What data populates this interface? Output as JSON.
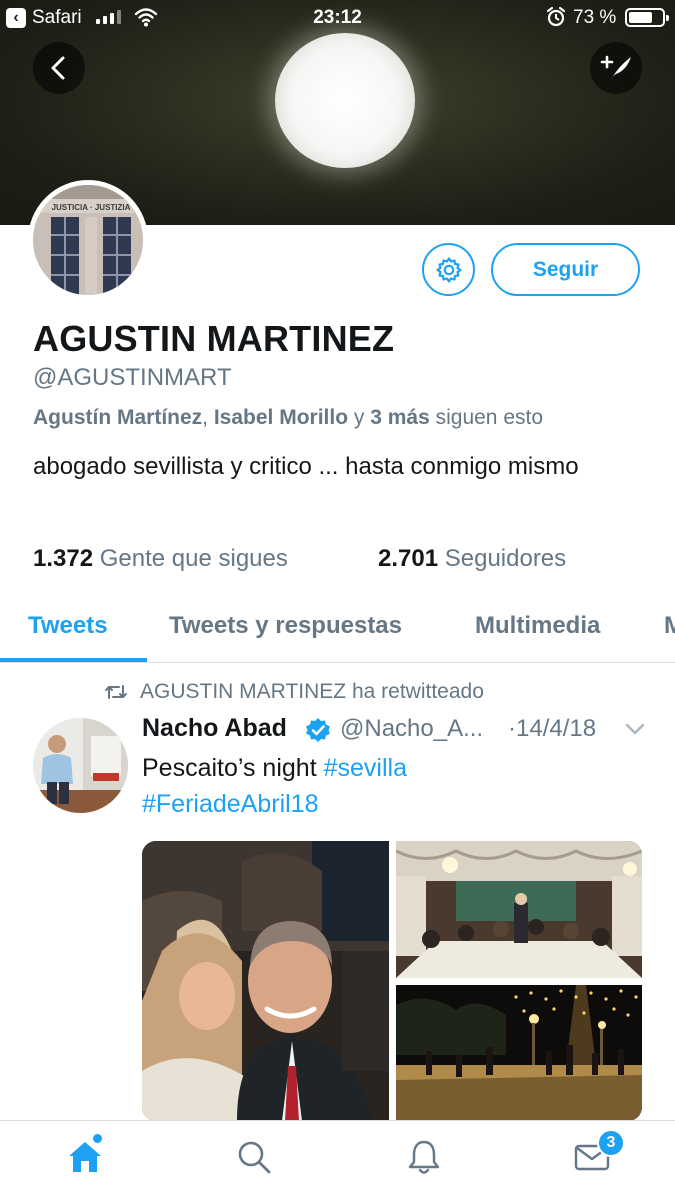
{
  "status_bar": {
    "back_app": "Safari",
    "time": "23:12",
    "battery_percent": "73 %",
    "battery_level": 0.73,
    "icons": [
      "signal-icon",
      "wifi-icon",
      "alarm-icon",
      "battery-icon"
    ]
  },
  "header": {
    "icons": [
      "back-arrow-icon",
      "compose-tweet-icon"
    ]
  },
  "profile": {
    "display_name": "AGUSTIN MARTINEZ",
    "handle": "@AGUSTINMART",
    "followed_by": {
      "name1": "Agustín Martínez",
      "sep": ", ",
      "name2": "Isabel Morillo",
      "and": " y ",
      "more": "3 más",
      "suffix": " siguen esto"
    },
    "bio": "abogado sevillista y critico ... hasta conmigo mismo",
    "following_count": "1.372",
    "following_label": "Gente que sigues",
    "followers_count": "2.701",
    "followers_label": "Seguidores",
    "follow_button": "Seguir",
    "avatar_sign": "JUSTICIA · JUSTIZIA"
  },
  "tabs": [
    {
      "label": "Tweets",
      "active": true
    },
    {
      "label": "Tweets y respuestas",
      "active": false
    },
    {
      "label": "Multimedia",
      "active": false
    },
    {
      "label": "M",
      "active": false
    }
  ],
  "tweet": {
    "retweet_label": "AGUSTIN MARTINEZ ha retwitteado",
    "author_name": "Nacho Abad",
    "author_handle": "@Nacho_A...",
    "date": "·14/4/18",
    "text_plain": "Pescaito’s night ",
    "hashtag1": "#sevilla",
    "hashtag2": "#FeriadeAbril18",
    "media_count": 3
  },
  "bottom_nav": {
    "items": [
      "home-icon",
      "search-icon",
      "notifications-icon",
      "messages-icon"
    ],
    "messages_badge": "3"
  },
  "colors": {
    "accent": "#1da1f2",
    "text_primary": "#14171a",
    "text_secondary": "#657786",
    "divider": "#d9dee2"
  }
}
